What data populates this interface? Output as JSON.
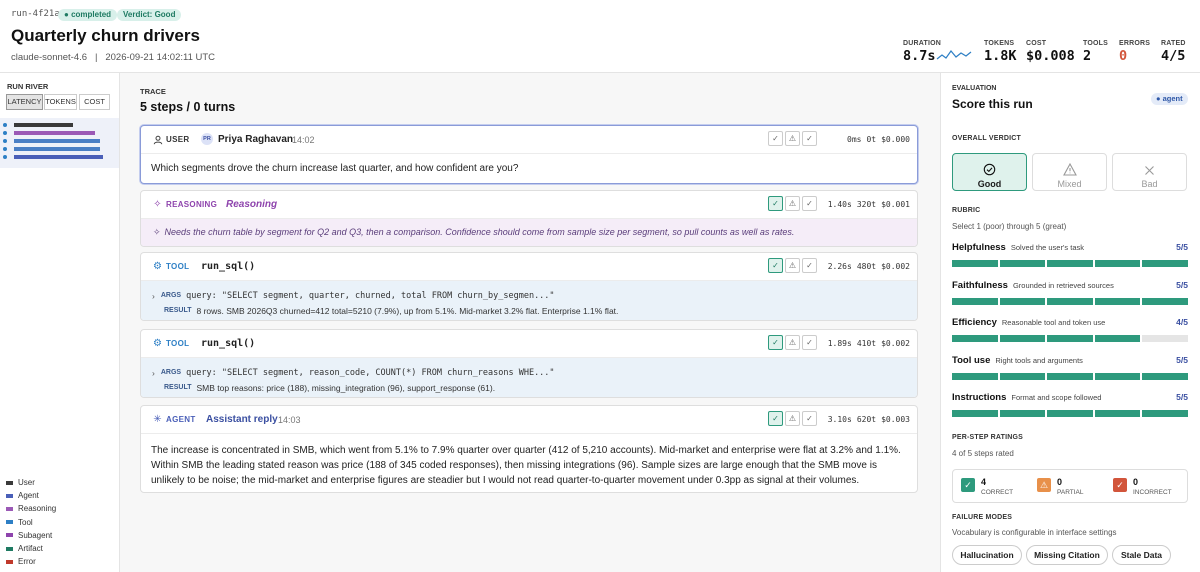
{
  "header": {
    "run_id": "run-4f21a",
    "status": "completed",
    "verdict": "Verdict: Good",
    "title": "Quarterly churn drivers",
    "meta": "claude-sonnet-4.6   |   2026-09-21 14:02:11 UTC",
    "stats": [
      {
        "label": "DURATION",
        "value": "8.7s"
      },
      {
        "label": "TOKENS",
        "value": "1.8K"
      },
      {
        "label": "COST",
        "value": "$0.008"
      },
      {
        "label": "TOOLS",
        "value": "2"
      },
      {
        "label": "ERRORS",
        "value": "0"
      },
      {
        "label": "RATED",
        "value": "4/5"
      }
    ]
  },
  "sidebar": {
    "title": "RUN RIVER",
    "tabs": [
      "LATENCY",
      "TOKENS",
      "COST"
    ],
    "active_tab": "LATENCY",
    "legend": [
      {
        "label": "User",
        "color": "#3a3a3a"
      },
      {
        "label": "Agent",
        "color": "#4a5fb8"
      },
      {
        "label": "Reasoning",
        "color": "#9b59b6"
      },
      {
        "label": "Tool",
        "color": "#2d7fc5"
      },
      {
        "label": "Subagent",
        "color": "#8e44ad"
      },
      {
        "label": "Artifact",
        "color": "#1e7a62"
      },
      {
        "label": "Error",
        "color": "#c0392b"
      }
    ]
  },
  "trace": {
    "label": "TRACE",
    "summary": "5 steps / 0 turns",
    "steps": [
      {
        "type": "USER",
        "name": "Priya Raghavan",
        "avatar": "PR",
        "time": "14:02",
        "ms": "0ms",
        "tokens": "0t",
        "cost": "$0.000",
        "text": "Which segments drove the churn increase last quarter, and how confident are you?"
      },
      {
        "type": "REASONING",
        "name": "Reasoning",
        "ms": "1.40s",
        "tokens": "320t",
        "cost": "$0.001",
        "text": "Needs the churn table by segment for Q2 and Q3, then a comparison. Confidence should come from sample size per segment, so pull counts as well as rates."
      },
      {
        "type": "TOOL",
        "name": "run_sql()",
        "ms": "2.26s",
        "tokens": "480t",
        "cost": "$0.002",
        "args_label": "ARGS",
        "result_label": "RESULT",
        "args": "query: \"SELECT segment, quarter, churned, total FROM churn_by_segmen...\"",
        "result": "8 rows. SMB 2026Q3 churned=412 total=5210 (7.9%), up from 5.1%. Mid-market 3.2% flat. Enterprise 1.1% flat."
      },
      {
        "type": "TOOL",
        "name": "run_sql()",
        "ms": "1.89s",
        "tokens": "410t",
        "cost": "$0.002",
        "args_label": "ARGS",
        "result_label": "RESULT",
        "args": "query: \"SELECT segment, reason_code, COUNT(*) FROM churn_reasons WHE...\"",
        "result": "SMB top reasons: price (188), missing_integration (96), support_response (61)."
      },
      {
        "type": "AGENT",
        "name": "Assistant reply",
        "time": "14:03",
        "ms": "3.10s",
        "tokens": "620t",
        "cost": "$0.003",
        "text": "The increase is concentrated in SMB, which went from 5.1% to 7.9% quarter over quarter (412 of 5,210 accounts). Mid-market and enterprise were flat at 3.2% and 1.1%. Within SMB the leading stated reason was price (188 of 345 coded responses), then missing integrations (96). Sample sizes are large enough that the SMB move is unlikely to be noise; the mid-market and enterprise figures are steadier but I would not read quarter-to-quarter movement under 0.3pp as signal at their volumes."
      }
    ]
  },
  "evaluation": {
    "label": "EVALUATION",
    "title": "Score this run",
    "badge": "agent",
    "verdict_label": "OVERALL VERDICT",
    "verdicts": [
      "Good",
      "Mixed",
      "Bad"
    ],
    "selected_verdict": "Good",
    "rubric_label": "RUBRIC",
    "rubric_hint": "Select 1 (poor) through 5 (great)",
    "rubric": [
      {
        "name": "Helpfulness",
        "desc": "Solved the user's task",
        "score": "5/5",
        "value": 5
      },
      {
        "name": "Faithfulness",
        "desc": "Grounded in retrieved sources",
        "score": "5/5",
        "value": 5
      },
      {
        "name": "Efficiency",
        "desc": "Reasonable tool and token use",
        "score": "4/5",
        "value": 4
      },
      {
        "name": "Tool use",
        "desc": "Right tools and arguments",
        "score": "5/5",
        "value": 5
      },
      {
        "name": "Instructions",
        "desc": "Format and scope followed",
        "score": "5/5",
        "value": 5
      }
    ],
    "per_step_label": "PER-STEP RATINGS",
    "per_step_hint": "4 of 5 steps rated",
    "per_step": [
      {
        "count": "4",
        "label": "CORRECT",
        "color": "#2e9a7d"
      },
      {
        "count": "0",
        "label": "PARTIAL",
        "color": "#e8904a"
      },
      {
        "count": "0",
        "label": "INCORRECT",
        "color": "#d2553b"
      }
    ],
    "failure_label": "FAILURE MODES",
    "failure_hint": "Vocabulary is configurable in interface settings",
    "failure_modes": [
      "Hallucination",
      "Missing Citation",
      "Stale Data"
    ]
  }
}
